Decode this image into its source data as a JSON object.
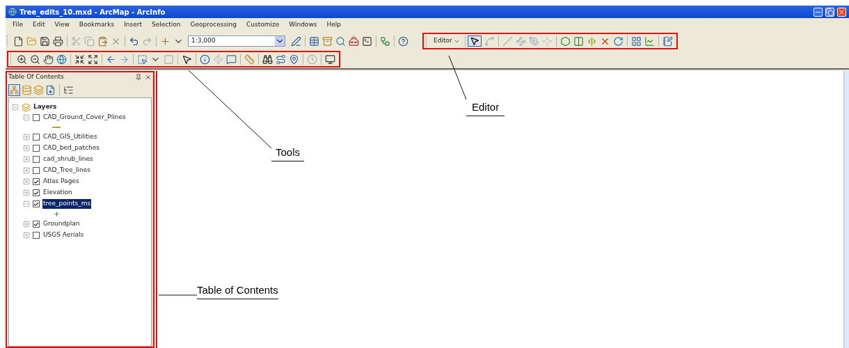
{
  "window": {
    "title": "Tree_edits_10.mxd - ArcMap - ArcInfo"
  },
  "menu": [
    "File",
    "Edit",
    "View",
    "Bookmarks",
    "Insert",
    "Selection",
    "Geoprocessing",
    "Customize",
    "Windows",
    "Help"
  ],
  "standard_toolbar": {
    "scale": "1:3,000"
  },
  "tools_toolbar": {
    "highlighted": true
  },
  "editor_toolbar": {
    "highlighted": true,
    "menu": "Editor"
  },
  "table_of_contents": {
    "title": "Table Of Contents",
    "highlighted": true,
    "root": {
      "label": "Layers",
      "expanded": true,
      "children": [
        {
          "label": "CAD_Ground_Cover_Plines",
          "checked": false,
          "expanded": true,
          "selected": false,
          "legend": {
            "kind": "line"
          }
        },
        {
          "label": "CAD_GIS_Utilities",
          "checked": false,
          "expanded": false,
          "selected": false
        },
        {
          "label": "CAD_bed_patches",
          "checked": false,
          "expanded": false,
          "selected": false
        },
        {
          "label": "cad_shrub_lines",
          "checked": false,
          "expanded": false,
          "selected": false
        },
        {
          "label": "CAD_Tree_lines",
          "checked": false,
          "expanded": false,
          "selected": false
        },
        {
          "label": "Atlas Pages",
          "checked": true,
          "expanded": false,
          "selected": false
        },
        {
          "label": "Elevation",
          "checked": true,
          "expanded": false,
          "selected": false
        },
        {
          "label": "tree_points_ms",
          "checked": true,
          "expanded": true,
          "selected": true,
          "legend": {
            "kind": "point"
          }
        },
        {
          "label": "Groundplan",
          "checked": true,
          "expanded": false,
          "selected": false
        },
        {
          "label": "USGS Aerials",
          "checked": false,
          "expanded": false,
          "selected": false
        }
      ]
    }
  },
  "annotations": [
    {
      "label": "Editor"
    },
    {
      "label": "Tools"
    },
    {
      "label": "Table of Contents"
    }
  ]
}
